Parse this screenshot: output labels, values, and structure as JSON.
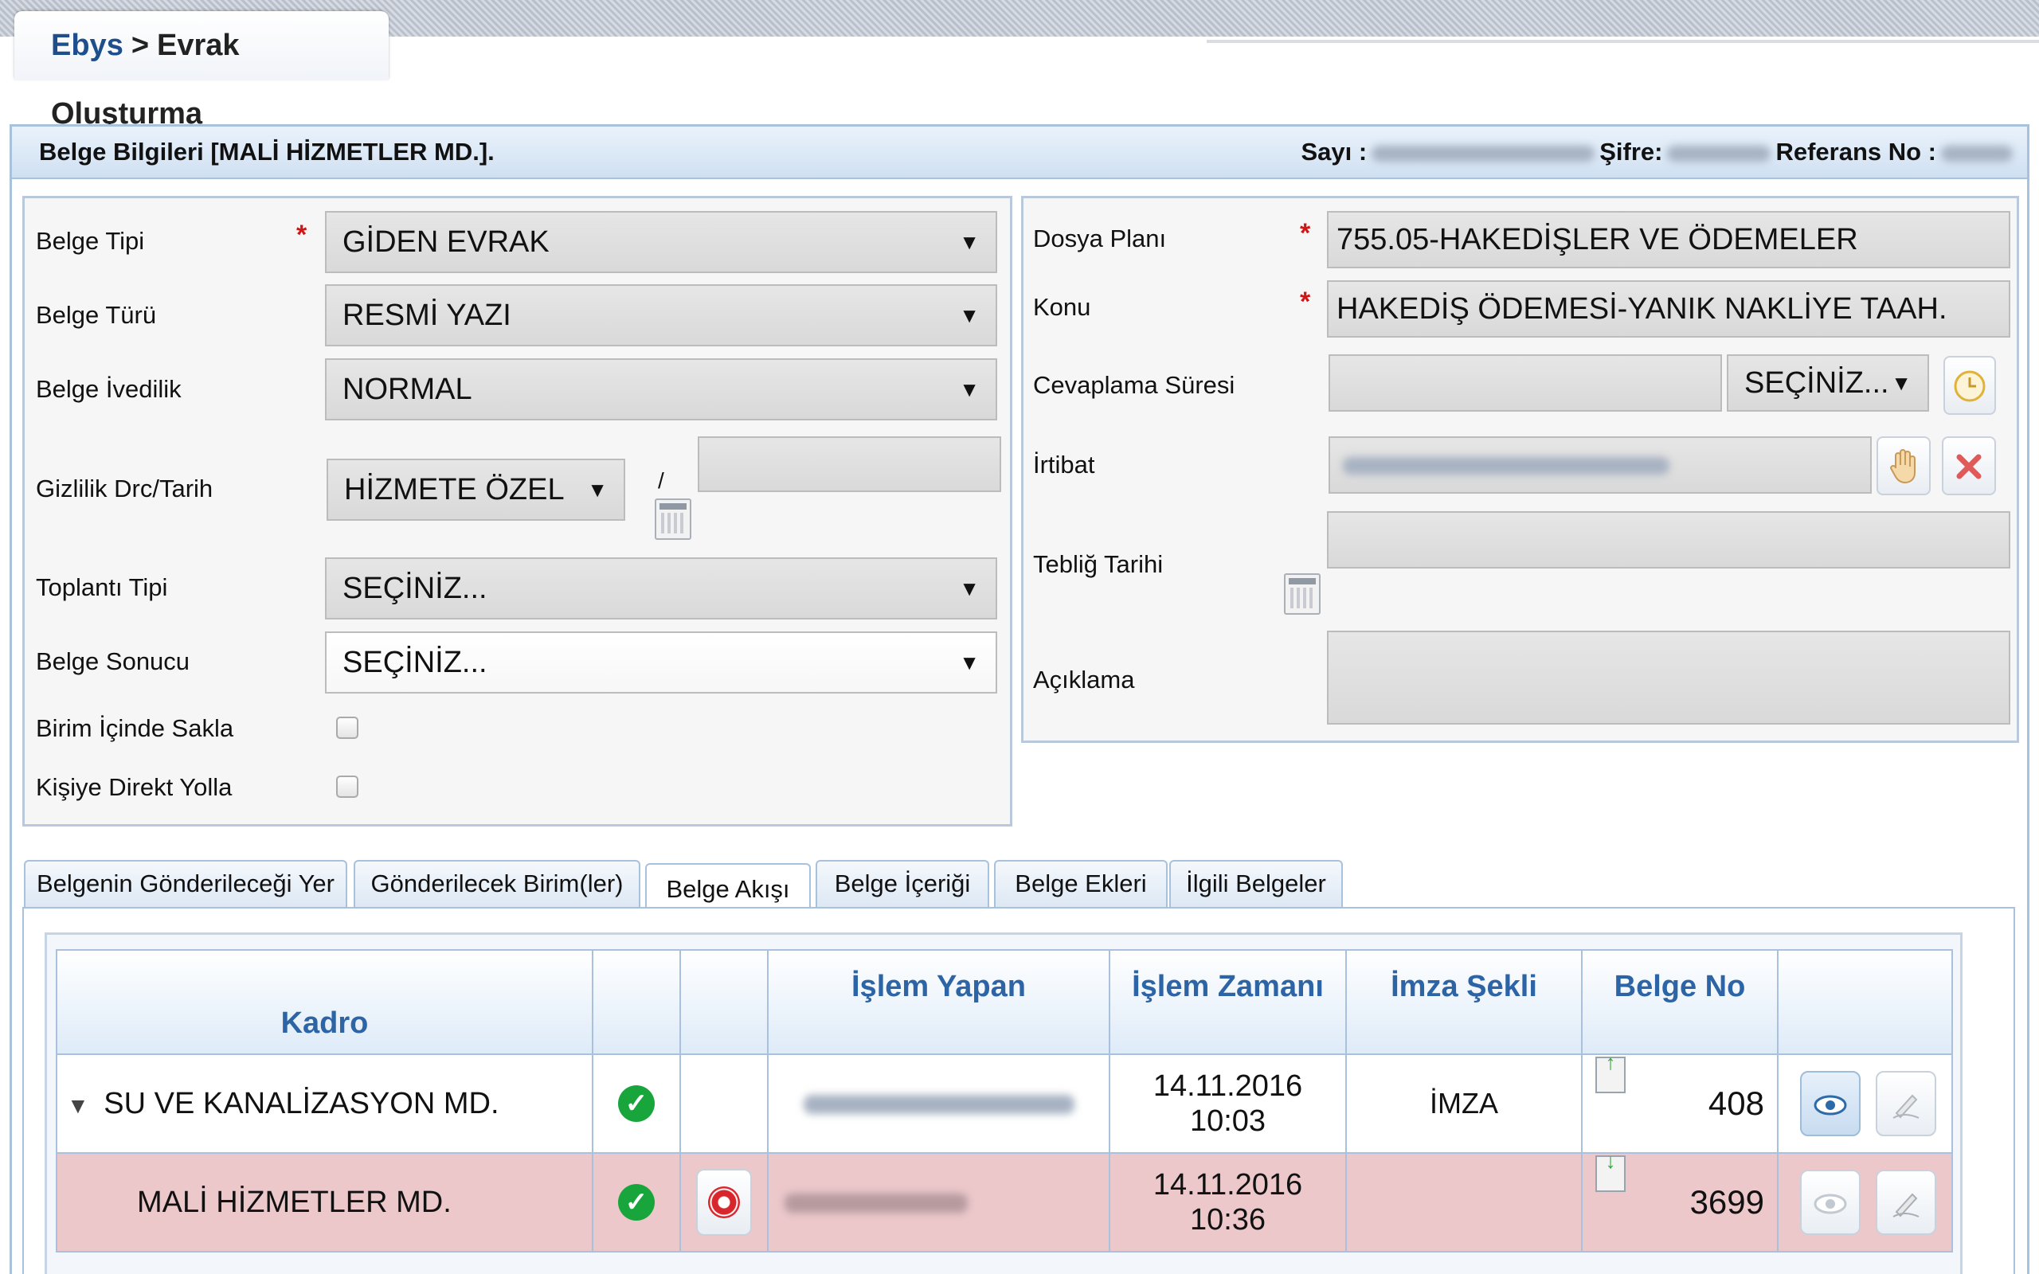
{
  "breadcrumb": {
    "root": "Ebys",
    "separator": ">",
    "current": "Evrak Oluşturma"
  },
  "header": {
    "title": "Belge Bilgileri [MALİ HİZMETLER MD.].",
    "sayi_label": "Sayı :",
    "sifre_label": "Şifre:",
    "referans_label": "Referans No :"
  },
  "left_form": {
    "belge_tipi": {
      "label": "Belge Tipi",
      "value": "GİDEN EVRAK"
    },
    "belge_turu": {
      "label": "Belge Türü",
      "value": "RESMİ YAZI"
    },
    "belge_ivedilik": {
      "label": "Belge İvedilik",
      "value": "NORMAL"
    },
    "gizlilik": {
      "label": "Gizlilik Drc/Tarih",
      "value": "HİZMETE ÖZEL",
      "slash": "/",
      "date_value": ""
    },
    "toplanti_tipi": {
      "label": "Toplantı Tipi",
      "value": "SEÇİNİZ..."
    },
    "belge_sonucu": {
      "label": "Belge Sonucu",
      "value": "SEÇİNİZ..."
    },
    "birim_icinde_sakla": {
      "label": "Birim İçinde Sakla"
    },
    "kisiye_direkt_yolla": {
      "label": "Kişiye Direkt Yolla"
    },
    "required_mark": "*",
    "arrow": "▼"
  },
  "right_form": {
    "dosya_plani": {
      "label": "Dosya Planı",
      "value": "755.05-HAKEDİŞLER VE ÖDEMELER"
    },
    "konu": {
      "label": "Konu",
      "value": "HAKEDİŞ ÖDEMESİ-YANIK NAKLİYE TAAH."
    },
    "cevaplama_suresi": {
      "label": "Cevaplama Süresi",
      "value": "",
      "select_value": "SEÇİNİZ..."
    },
    "irtibat": {
      "label": "İrtibat"
    },
    "teblig_tarihi": {
      "label": "Tebliğ Tarihi",
      "value": ""
    },
    "aciklama": {
      "label": "Açıklama",
      "value": ""
    }
  },
  "tabs": [
    {
      "label": "Belgenin Gönderileceği Yer"
    },
    {
      "label": "Gönderilecek Birim(ler)"
    },
    {
      "label": "Belge Akışı"
    },
    {
      "label": "Belge İçeriği"
    },
    {
      "label": "Belge Ekleri"
    },
    {
      "label": "İlgili Belgeler"
    }
  ],
  "active_tab": "Belge Akışı",
  "grid": {
    "columns": [
      "Kadro",
      "",
      "",
      "İşlem Yapan",
      "İşlem Zamanı",
      "İmza Şekli",
      "Belge No",
      ""
    ],
    "rows": [
      {
        "expander": "▼",
        "kadro": "SU VE KANALİZASYON MD.",
        "status": "✓",
        "date": "14.11.2016",
        "time": "10:03",
        "imza": "İMZA",
        "belge_no": "408",
        "arrow": "↑"
      },
      {
        "kadro": "MALİ HİZMETLER MD.",
        "status": "✓",
        "date": "14.11.2016",
        "time": "10:36",
        "imza": "",
        "belge_no": "3699",
        "arrow": "↓"
      }
    ]
  },
  "colors": {
    "accent": "#2d64a6",
    "header_bg": "#cfe0f2",
    "highlight_row": "#ecc8cb",
    "required": "#d31414",
    "ok": "#18a63c"
  }
}
